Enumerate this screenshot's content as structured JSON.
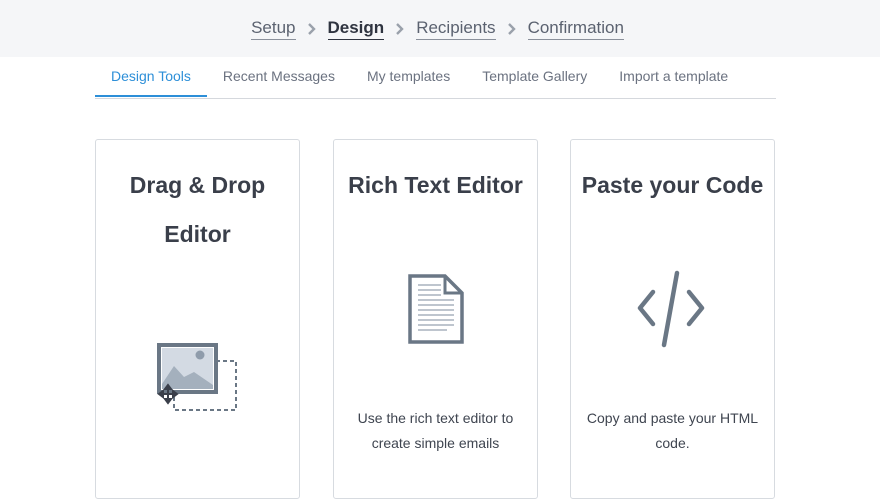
{
  "steps": {
    "items": [
      {
        "label": "Setup",
        "active": false
      },
      {
        "label": "Design",
        "active": true
      },
      {
        "label": "Recipients",
        "active": false
      },
      {
        "label": "Confirmation",
        "active": false
      }
    ]
  },
  "tabs": [
    {
      "label": "Design Tools",
      "active": true
    },
    {
      "label": "Recent Messages",
      "active": false
    },
    {
      "label": "My templates",
      "active": false
    },
    {
      "label": "Template Gallery",
      "active": false
    },
    {
      "label": "Import a template",
      "active": false
    }
  ],
  "cards": [
    {
      "title_line1": "Drag & Drop",
      "title_line2": "Editor",
      "icon": "drag-drop-image-icon",
      "description": ""
    },
    {
      "title_line1": "Rich Text Editor",
      "icon": "document-icon",
      "description": "Use the rich text editor to create simple emails"
    },
    {
      "title_line1": "Paste your Code",
      "icon": "code-icon",
      "description": "Copy and paste your HTML code."
    }
  ],
  "colors": {
    "accent": "#2d8fd8",
    "icon": "#6a7785",
    "text": "#3a3f4a"
  }
}
